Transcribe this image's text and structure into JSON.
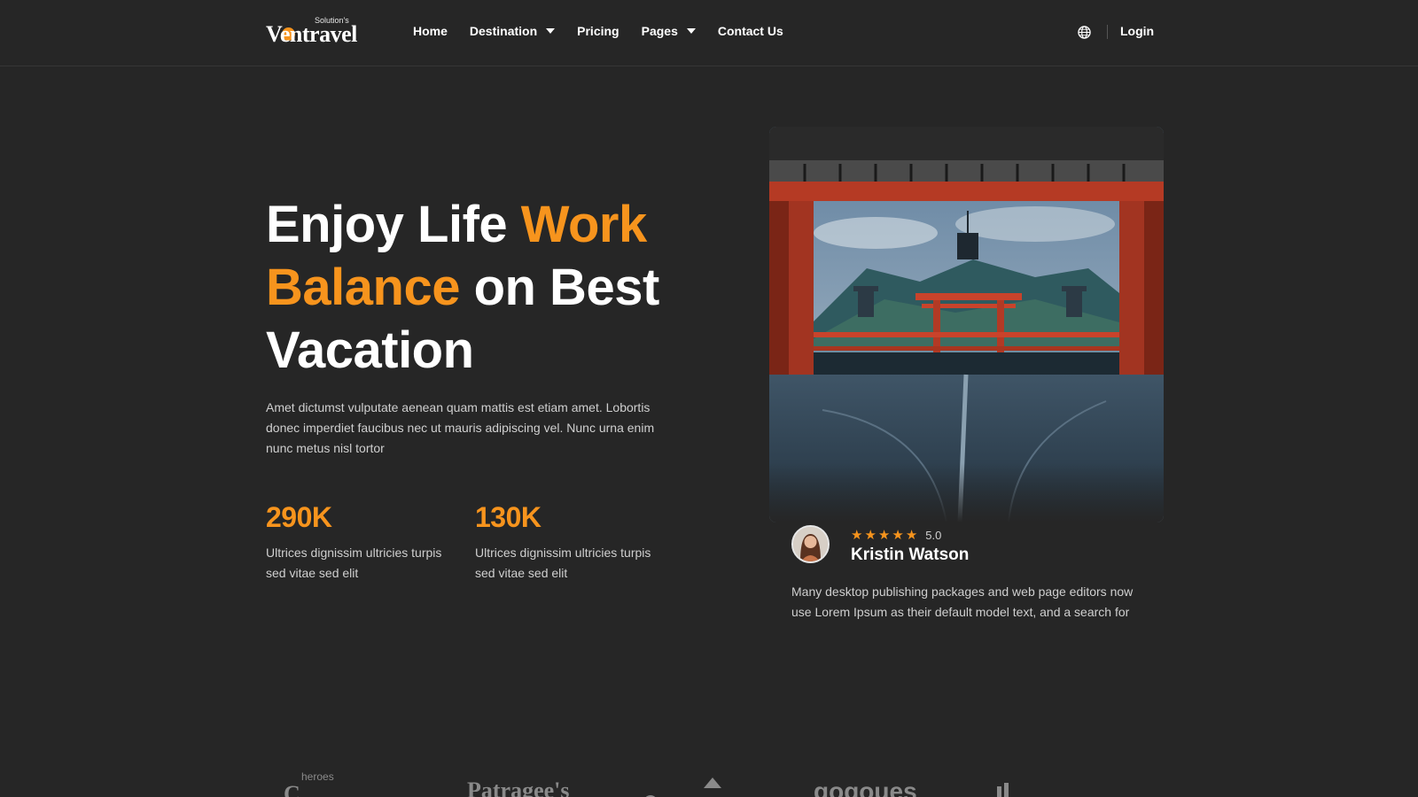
{
  "header": {
    "logo_sub": "Solution's",
    "logo_main": "Ventravel",
    "nav": [
      {
        "label": "Home",
        "dropdown": false
      },
      {
        "label": "Destination",
        "dropdown": true
      },
      {
        "label": "Pricing",
        "dropdown": false
      },
      {
        "label": "Pages",
        "dropdown": true
      },
      {
        "label": "Contact Us",
        "dropdown": false
      }
    ],
    "language_icon": "globe-icon",
    "login_label": "Login"
  },
  "hero": {
    "title_part1": "Enjoy Life ",
    "title_accent1": "Work",
    "title_accent2": "Balance",
    "title_part2": " on Best",
    "title_part3": "Vacation",
    "description": "Amet dictumst vulputate aenean quam mattis est etiam amet. Lobortis donec imperdiet faucibus nec ut mauris adipiscing vel. Nunc urna enim nunc metus nisl tortor",
    "stats": [
      {
        "value": "290K",
        "label": "Ultrices dignissim ultricies turpis sed vitae sed elit"
      },
      {
        "value": "130K",
        "label": "Ultrices dignissim ultricies turpis sed vitae sed elit"
      }
    ]
  },
  "testimonial": {
    "rating": "5.0",
    "stars": 5,
    "name": "Kristin Watson",
    "text": "Many desktop publishing packages and web page editors now use Lorem Ipsum as their default model text, and a search for"
  },
  "partners": [
    {
      "name": "heroes"
    },
    {
      "name": "Patragee's"
    },
    {
      "name": "gogoues"
    }
  ],
  "colors": {
    "background": "#262626",
    "accent": "#f7941d",
    "text_muted": "#cfcfcf"
  }
}
